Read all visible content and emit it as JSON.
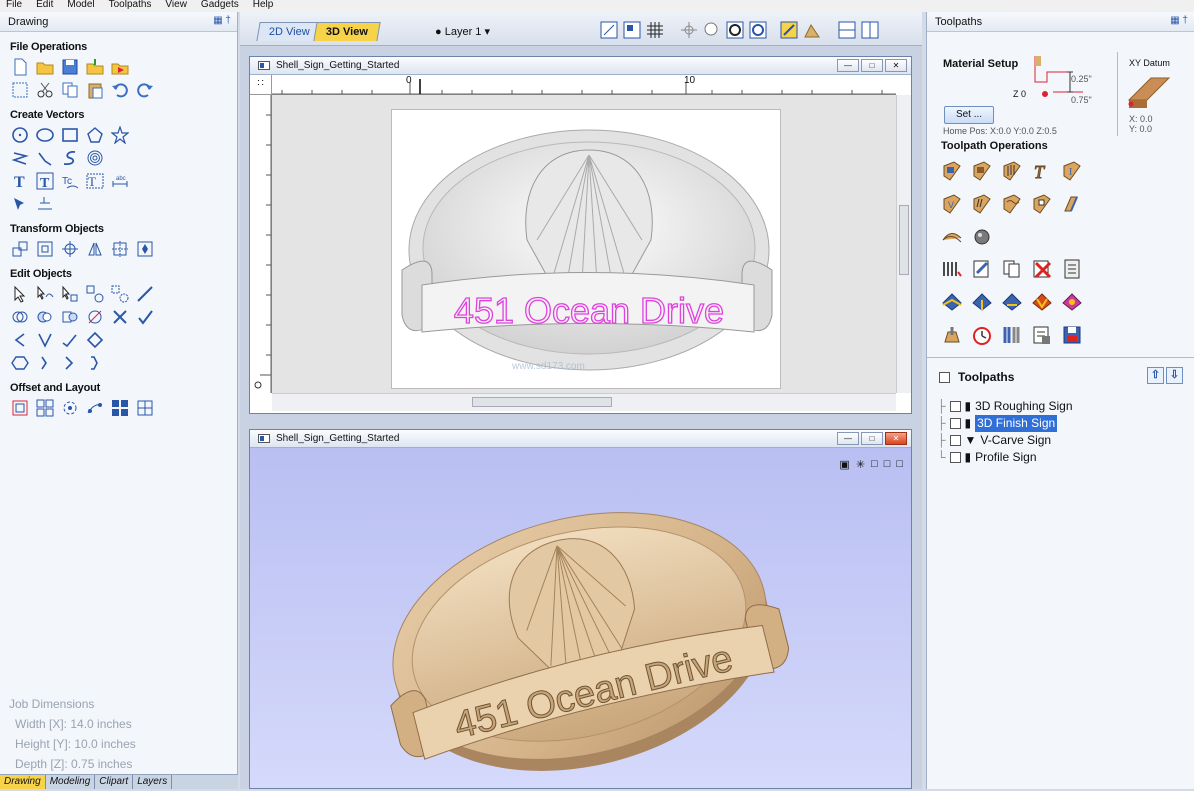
{
  "menu": [
    "File",
    "Edit",
    "Model",
    "Toolpaths",
    "View",
    "Gadgets",
    "Help"
  ],
  "left_panel": {
    "title": "Drawing",
    "sections": {
      "file_operations": "File Operations",
      "create_vectors": "Create Vectors",
      "transform_objects": "Transform Objects",
      "edit_objects": "Edit Objects",
      "offset_layout": "Offset and Layout"
    },
    "job_dimensions": {
      "title": "Job Dimensions",
      "width": "Width  [X]: 14.0 inches",
      "height": "Height [Y]: 10.0 inches",
      "depth": "Depth  [Z]: 0.75 inches"
    },
    "bottom_tabs": [
      "Drawing",
      "Modeling",
      "Clipart",
      "Layers"
    ]
  },
  "view_tabs": {
    "tab_2d": "2D View",
    "tab_3d": "3D View"
  },
  "layer": "Layer 1",
  "window_2d": {
    "title": "Shell_Sign_Getting_Started",
    "ruler_labels": [
      "0",
      "10"
    ],
    "sign_text": "451 Ocean Drive",
    "watermark": "www.sd173.com"
  },
  "window_3d": {
    "title": "Shell_Sign_Getting_Started",
    "sign_text": "451 Ocean Drive"
  },
  "right_panel": {
    "title": "Toolpaths",
    "material_setup": {
      "title": "Material Setup",
      "set_button": "Set ...",
      "z0": "Z 0",
      "dim_top": "0.25\"",
      "dim_bottom": "0.75\"",
      "home_pos": "Home Pos:  X:0.0 Y:0.0 Z:0.5",
      "xy_datum": "XY Datum",
      "datum_x": "X: 0.0",
      "datum_y": "Y: 0.0"
    },
    "toolpath_operations": "Toolpath Operations",
    "toolpaths_header": "Toolpaths",
    "toolpaths": [
      "3D Roughing Sign",
      "3D Finish Sign",
      "V-Carve Sign",
      "Profile Sign"
    ]
  },
  "colors": {
    "accent_tab": "#f7d34a",
    "selection": "#2f6fd6",
    "sign_outline": "#e040e0",
    "wood": "#d9b991",
    "viewport3d": "#c8ccf7"
  }
}
